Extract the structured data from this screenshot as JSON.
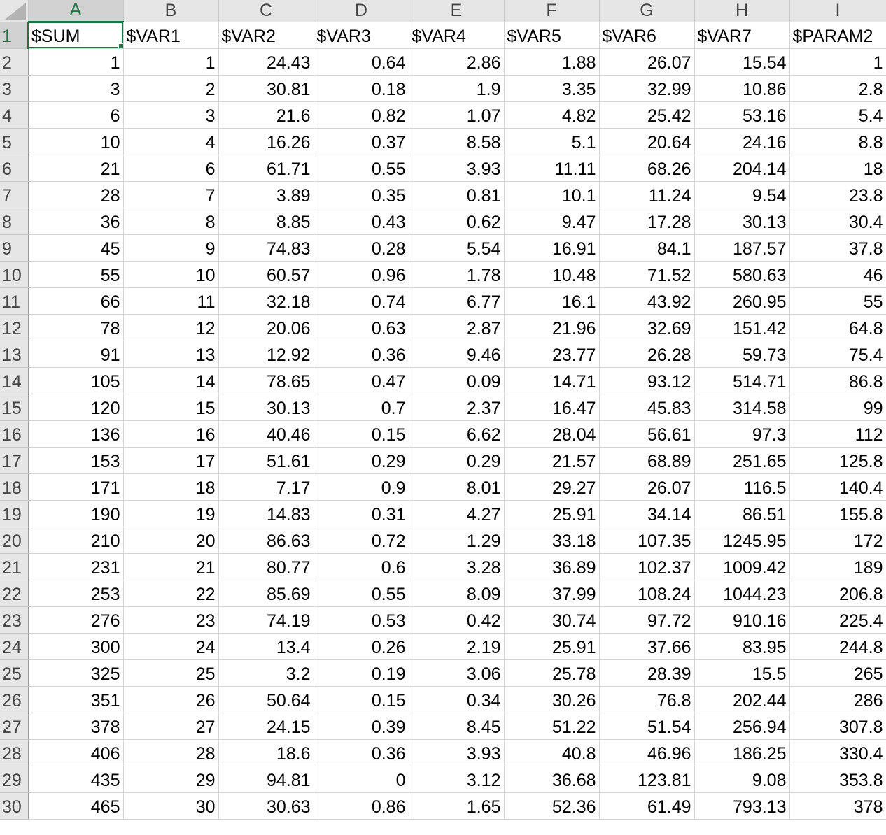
{
  "columns": [
    "A",
    "B",
    "C",
    "D",
    "E",
    "F",
    "G",
    "H",
    "I"
  ],
  "active_cell": "A1",
  "colors": {
    "accent": "#217346",
    "header_bg": "#e6e6e6",
    "gridline": "#d4d4d4"
  },
  "rows": [
    {
      "n": "1",
      "cells": [
        "$SUM",
        "$VAR1",
        "$VAR2",
        "$VAR3",
        "$VAR4",
        "$VAR5",
        "$VAR6",
        "$VAR7",
        "$PARAM2"
      ]
    },
    {
      "n": "2",
      "cells": [
        "1",
        "1",
        "24.43",
        "0.64",
        "2.86",
        "1.88",
        "26.07",
        "15.54",
        "1"
      ]
    },
    {
      "n": "3",
      "cells": [
        "3",
        "2",
        "30.81",
        "0.18",
        "1.9",
        "3.35",
        "32.99",
        "10.86",
        "2.8"
      ]
    },
    {
      "n": "4",
      "cells": [
        "6",
        "3",
        "21.6",
        "0.82",
        "1.07",
        "4.82",
        "25.42",
        "53.16",
        "5.4"
      ]
    },
    {
      "n": "5",
      "cells": [
        "10",
        "4",
        "16.26",
        "0.37",
        "8.58",
        "5.1",
        "20.64",
        "24.16",
        "8.8"
      ]
    },
    {
      "n": "6",
      "cells": [
        "21",
        "6",
        "61.71",
        "0.55",
        "3.93",
        "11.11",
        "68.26",
        "204.14",
        "18"
      ]
    },
    {
      "n": "7",
      "cells": [
        "28",
        "7",
        "3.89",
        "0.35",
        "0.81",
        "10.1",
        "11.24",
        "9.54",
        "23.8"
      ]
    },
    {
      "n": "8",
      "cells": [
        "36",
        "8",
        "8.85",
        "0.43",
        "0.62",
        "9.47",
        "17.28",
        "30.13",
        "30.4"
      ]
    },
    {
      "n": "9",
      "cells": [
        "45",
        "9",
        "74.83",
        "0.28",
        "5.54",
        "16.91",
        "84.1",
        "187.57",
        "37.8"
      ]
    },
    {
      "n": "10",
      "cells": [
        "55",
        "10",
        "60.57",
        "0.96",
        "1.78",
        "10.48",
        "71.52",
        "580.63",
        "46"
      ]
    },
    {
      "n": "11",
      "cells": [
        "66",
        "11",
        "32.18",
        "0.74",
        "6.77",
        "16.1",
        "43.92",
        "260.95",
        "55"
      ]
    },
    {
      "n": "12",
      "cells": [
        "78",
        "12",
        "20.06",
        "0.63",
        "2.87",
        "21.96",
        "32.69",
        "151.42",
        "64.8"
      ]
    },
    {
      "n": "13",
      "cells": [
        "91",
        "13",
        "12.92",
        "0.36",
        "9.46",
        "23.77",
        "26.28",
        "59.73",
        "75.4"
      ]
    },
    {
      "n": "14",
      "cells": [
        "105",
        "14",
        "78.65",
        "0.47",
        "0.09",
        "14.71",
        "93.12",
        "514.71",
        "86.8"
      ]
    },
    {
      "n": "15",
      "cells": [
        "120",
        "15",
        "30.13",
        "0.7",
        "2.37",
        "16.47",
        "45.83",
        "314.58",
        "99"
      ]
    },
    {
      "n": "16",
      "cells": [
        "136",
        "16",
        "40.46",
        "0.15",
        "6.62",
        "28.04",
        "56.61",
        "97.3",
        "112"
      ]
    },
    {
      "n": "17",
      "cells": [
        "153",
        "17",
        "51.61",
        "0.29",
        "0.29",
        "21.57",
        "68.89",
        "251.65",
        "125.8"
      ]
    },
    {
      "n": "18",
      "cells": [
        "171",
        "18",
        "7.17",
        "0.9",
        "8.01",
        "29.27",
        "26.07",
        "116.5",
        "140.4"
      ]
    },
    {
      "n": "19",
      "cells": [
        "190",
        "19",
        "14.83",
        "0.31",
        "4.27",
        "25.91",
        "34.14",
        "86.51",
        "155.8"
      ]
    },
    {
      "n": "20",
      "cells": [
        "210",
        "20",
        "86.63",
        "0.72",
        "1.29",
        "33.18",
        "107.35",
        "1245.95",
        "172"
      ]
    },
    {
      "n": "21",
      "cells": [
        "231",
        "21",
        "80.77",
        "0.6",
        "3.28",
        "36.89",
        "102.37",
        "1009.42",
        "189"
      ]
    },
    {
      "n": "22",
      "cells": [
        "253",
        "22",
        "85.69",
        "0.55",
        "8.09",
        "37.99",
        "108.24",
        "1044.23",
        "206.8"
      ]
    },
    {
      "n": "23",
      "cells": [
        "276",
        "23",
        "74.19",
        "0.53",
        "0.42",
        "30.74",
        "97.72",
        "910.16",
        "225.4"
      ]
    },
    {
      "n": "24",
      "cells": [
        "300",
        "24",
        "13.4",
        "0.26",
        "2.19",
        "25.91",
        "37.66",
        "83.95",
        "244.8"
      ]
    },
    {
      "n": "25",
      "cells": [
        "325",
        "25",
        "3.2",
        "0.19",
        "3.06",
        "25.78",
        "28.39",
        "15.5",
        "265"
      ]
    },
    {
      "n": "26",
      "cells": [
        "351",
        "26",
        "50.64",
        "0.15",
        "0.34",
        "30.26",
        "76.8",
        "202.44",
        "286"
      ]
    },
    {
      "n": "27",
      "cells": [
        "378",
        "27",
        "24.15",
        "0.39",
        "8.45",
        "51.22",
        "51.54",
        "256.94",
        "307.8"
      ]
    },
    {
      "n": "28",
      "cells": [
        "406",
        "28",
        "18.6",
        "0.36",
        "3.93",
        "40.8",
        "46.96",
        "186.25",
        "330.4"
      ]
    },
    {
      "n": "29",
      "cells": [
        "435",
        "29",
        "94.81",
        "0",
        "3.12",
        "36.68",
        "123.81",
        "9.08",
        "353.8"
      ]
    },
    {
      "n": "30",
      "cells": [
        "465",
        "30",
        "30.63",
        "0.86",
        "1.65",
        "52.36",
        "61.49",
        "793.13",
        "378"
      ]
    }
  ]
}
